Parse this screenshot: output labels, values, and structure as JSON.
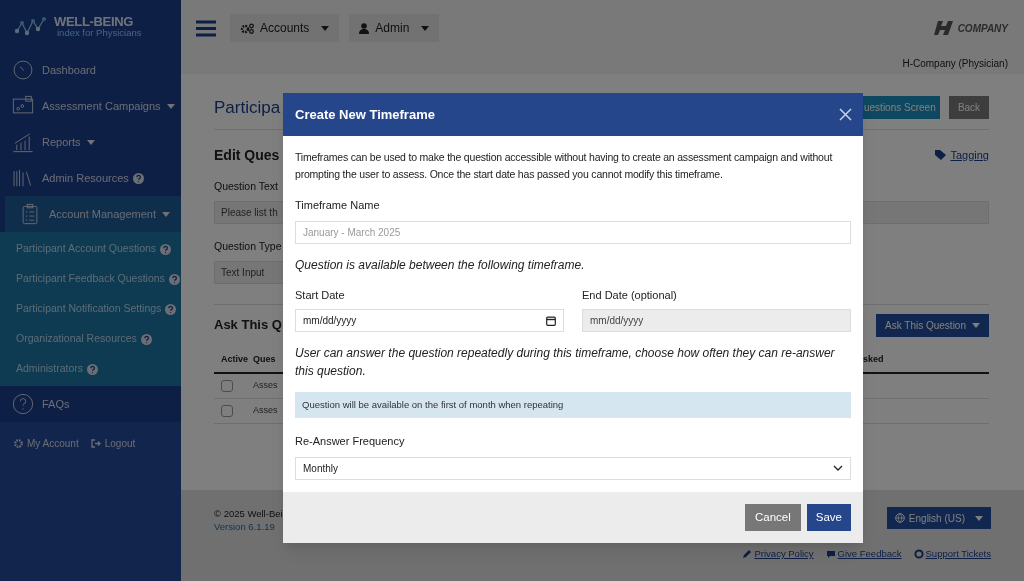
{
  "brand": {
    "name": "WELL-BEING",
    "tagline": "index for Physicians"
  },
  "sidebar": {
    "items": [
      {
        "label": "Dashboard",
        "caret": false,
        "help": false,
        "selected": false
      },
      {
        "label": "Assessment Campaigns",
        "caret": true,
        "help": false,
        "selected": false
      },
      {
        "label": "Reports",
        "caret": true,
        "help": false,
        "selected": false
      },
      {
        "label": "Admin Resources",
        "caret": false,
        "help": true,
        "selected": false
      },
      {
        "label": "Account Management",
        "caret": true,
        "help": false,
        "selected": true,
        "children": [
          {
            "label": "Participant Account Questions",
            "help": true
          },
          {
            "label": "Participant Feedback Questions",
            "help": true
          },
          {
            "label": "Participant Notification Settings",
            "help": true
          },
          {
            "label": "Organizational Resources",
            "help": true
          },
          {
            "label": "Administrators",
            "help": true
          }
        ]
      },
      {
        "label": "FAQs",
        "caret": false,
        "help": false,
        "selected": false
      }
    ],
    "footer_links": [
      "My Account",
      "Logout"
    ]
  },
  "topbar": {
    "menus": [
      "Accounts",
      "Admin"
    ],
    "logo": "COMPANY",
    "user": "H-Company (Physician)"
  },
  "page": {
    "title": "Participa",
    "buttons": [
      "uestions Screen",
      "Back"
    ],
    "section": "Edit Ques",
    "tagging": "Tagging",
    "fields": [
      {
        "label": "Question Text",
        "value": "Please list th",
        "wide": true
      },
      {
        "label": "Question Type",
        "value": "Text Input",
        "wide": false
      }
    ],
    "ask": {
      "title": "Ask This Q",
      "button": "Ask This Question",
      "columns": [
        "Active",
        "Ques",
        "sked"
      ],
      "rows": [
        {
          "checked": false,
          "cell": "Asses"
        },
        {
          "checked": false,
          "cell": "Asses"
        }
      ]
    }
  },
  "footer": {
    "copyright": "© 2025 Well-Bei",
    "version": "Version 6.1.19",
    "language": "English (US)",
    "links": [
      "Privacy Policy",
      "Give Feedback",
      "Support Tickets"
    ]
  },
  "modal": {
    "title": "Create New Timeframe",
    "intro": "Timeframes can be used to make the question accessible without having to create an assessment campaign and without prompting the user to assess. Once the start date has passed you cannot modify this timeframe.",
    "name_label": "Timeframe Name",
    "name_placeholder": "January - March 2025",
    "range_note": "Question is available between the following timeframe.",
    "dates": [
      {
        "label": "Start Date",
        "placeholder": "mm/dd/yyyy",
        "disabled": false
      },
      {
        "label": "End Date (optional)",
        "placeholder": "mm/dd/yyyy",
        "disabled": true
      }
    ],
    "repeat_note": "User can answer the question repeatedly during this timeframe, choose how often they can re-answer this question.",
    "info": "Question will be available on the first of month when repeating",
    "frequency_label": "Re-Answer Frequency",
    "frequency": "Monthly",
    "buttons": [
      "Cancel",
      "Save"
    ]
  }
}
